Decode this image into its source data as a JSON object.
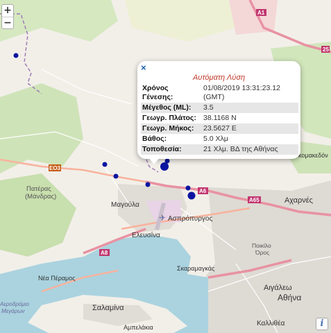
{
  "zoom": {
    "in_label": "+",
    "out_label": "−"
  },
  "popup": {
    "close_label": "×",
    "title": "Αυτόματη Λύση",
    "rows": [
      {
        "label": "Χρόνος Γένεσης:",
        "value": "01/08/2019 13:31:23.12 (GMT)"
      },
      {
        "label": "Μέγεθος (ML):",
        "value": "3.5"
      },
      {
        "label": "Γεωγρ. Πλάτος:",
        "value": "38.1168 N"
      },
      {
        "label": "Γεωγρ. Μήκος:",
        "value": "23.5627 E"
      },
      {
        "label": "Βάθος:",
        "value": "5.0 Χλμ"
      },
      {
        "label": "Τοποθεσία:",
        "value": "21 Χλμ. ΒΔ της Αθήνας"
      }
    ]
  },
  "places": {
    "pateras": "Πατέρας",
    "mandras": "(Μάνδρας)",
    "magoula": "Μαγούλα",
    "aspropyrgos": "Ασπρόπυργος",
    "elefsina": "Ελευσίνα",
    "acharnes": "Αχαρνές",
    "poikilo": "Ποικίλο",
    "oros": "Όρος",
    "nea_peramos": "Νέα Πέραμος",
    "skaramagkas": "Σκαραμαγκάς",
    "aigaleo": "Αιγάλεω",
    "athina": "Αθήνα",
    "salamina": "Σαλαμίνα",
    "ampelakia": "Αμπελάκια",
    "kallithea": "Καλλιθέα",
    "airport": "Αεροδρόμιο",
    "megara": "Μεγάρων",
    "kato": "κομακεδόν"
  },
  "roads": {
    "a1": "A1",
    "a25": "25",
    "e03": "ΕΟ3",
    "a6": "A6",
    "a65": "A65",
    "a8": "A8"
  },
  "info_label": "i",
  "colors": {
    "marker": "#0a14a0",
    "sea": "#aad3df",
    "urban": "#dadada",
    "forest": "#c6dfad",
    "motorway": "#e892a2",
    "trunk": "#f9b29c",
    "border": "#9e7bb4"
  }
}
